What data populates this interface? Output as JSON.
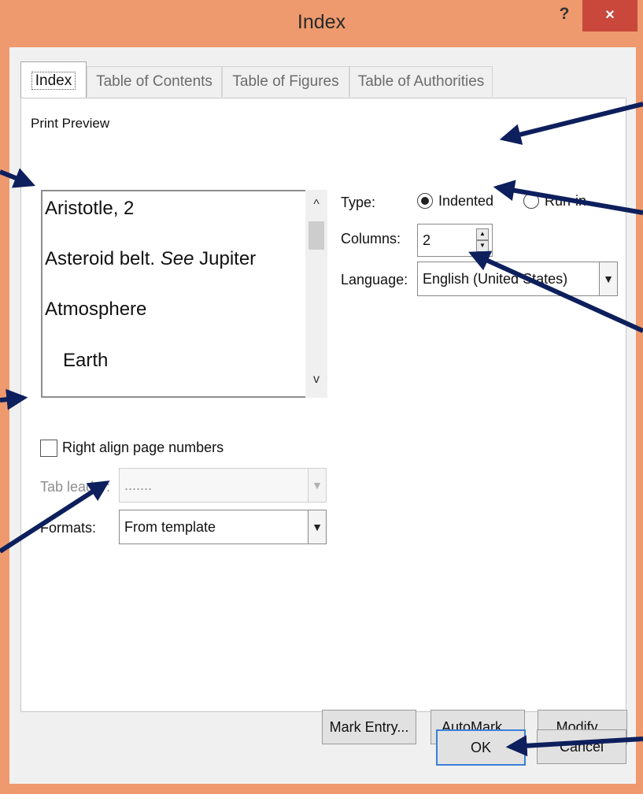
{
  "window": {
    "title": "Index",
    "help_label": "?",
    "close_label": "×"
  },
  "tabs": [
    "Index",
    "Table of Contents",
    "Table of Figures",
    "Table of Authorities"
  ],
  "preview": {
    "label": "Print Preview",
    "entries": [
      {
        "text": "Aristotle, 2"
      },
      {
        "text": "Asteroid belt. ",
        "italic": "See",
        "tail": " Jupiter"
      },
      {
        "text": "Atmosphere"
      },
      {
        "text": "Earth"
      }
    ],
    "scroll_up": "^",
    "scroll_down": "v"
  },
  "type": {
    "label": "Type:",
    "options": [
      "Indented",
      "Run-in"
    ],
    "selected": "Indented"
  },
  "columns": {
    "label": "Columns:",
    "value": "2"
  },
  "language": {
    "label": "Language:",
    "value": "English (United States)"
  },
  "right_align": {
    "label": "Right align page numbers",
    "checked": false
  },
  "tab_leader": {
    "label": "Tab leader:",
    "value": "......."
  },
  "formats": {
    "label": "Formats:",
    "value": "From template"
  },
  "buttons": {
    "mark_entry": "Mark Entry...",
    "automark": "AutoMark...",
    "modify": "Modify...",
    "ok": "OK",
    "cancel": "Cancel"
  },
  "colors": {
    "frame": "#ee9a6e",
    "close": "#c9483b",
    "arrow": "#0d1f5c"
  },
  "icons": [
    "close-icon",
    "help-icon",
    "dropdown-arrow-icon",
    "spin-up-icon",
    "spin-down-icon",
    "scroll-up-icon",
    "scroll-down-icon"
  ]
}
